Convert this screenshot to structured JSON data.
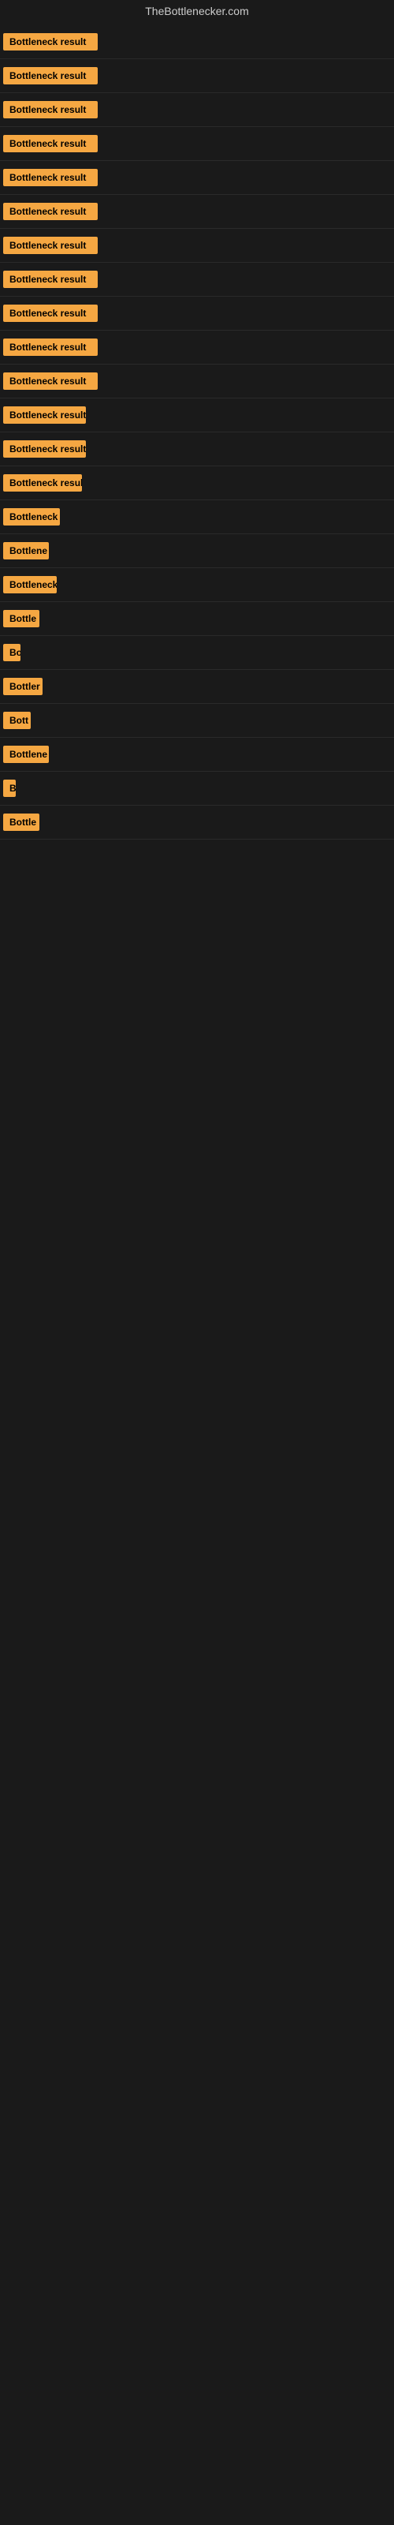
{
  "site": {
    "title": "TheBottlenecker.com"
  },
  "rows": [
    {
      "id": 1,
      "label": "Bottleneck result",
      "width": 120
    },
    {
      "id": 2,
      "label": "Bottleneck result",
      "width": 120
    },
    {
      "id": 3,
      "label": "Bottleneck result",
      "width": 120
    },
    {
      "id": 4,
      "label": "Bottleneck result",
      "width": 120
    },
    {
      "id": 5,
      "label": "Bottleneck result",
      "width": 120
    },
    {
      "id": 6,
      "label": "Bottleneck result",
      "width": 120
    },
    {
      "id": 7,
      "label": "Bottleneck result",
      "width": 120
    },
    {
      "id": 8,
      "label": "Bottleneck result",
      "width": 120
    },
    {
      "id": 9,
      "label": "Bottleneck result",
      "width": 120
    },
    {
      "id": 10,
      "label": "Bottleneck result",
      "width": 120
    },
    {
      "id": 11,
      "label": "Bottleneck result",
      "width": 120
    },
    {
      "id": 12,
      "label": "Bottleneck result",
      "width": 105
    },
    {
      "id": 13,
      "label": "Bottleneck result",
      "width": 105
    },
    {
      "id": 14,
      "label": "Bottleneck result",
      "width": 100
    },
    {
      "id": 15,
      "label": "Bottleneck r",
      "width": 72
    },
    {
      "id": 16,
      "label": "Bottlene",
      "width": 58
    },
    {
      "id": 17,
      "label": "Bottleneck",
      "width": 68
    },
    {
      "id": 18,
      "label": "Bottle",
      "width": 46
    },
    {
      "id": 19,
      "label": "Bo",
      "width": 22
    },
    {
      "id": 20,
      "label": "Bottler",
      "width": 50
    },
    {
      "id": 21,
      "label": "Bott",
      "width": 35
    },
    {
      "id": 22,
      "label": "Bottlene",
      "width": 58
    },
    {
      "id": 23,
      "label": "B",
      "width": 14
    },
    {
      "id": 24,
      "label": "Bottle",
      "width": 46
    }
  ]
}
